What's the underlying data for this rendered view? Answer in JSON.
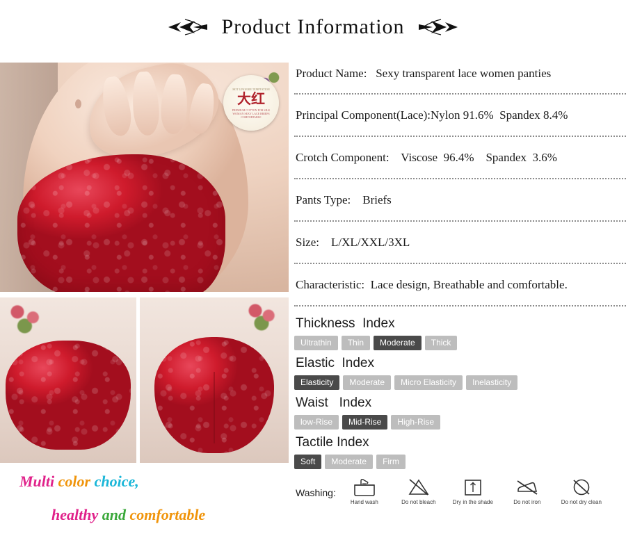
{
  "header": {
    "title": "Product  Information",
    "left_ornament_icon": "ornament-arrow-left-icon",
    "right_ornament_icon": "ornament-arrow-right-icon"
  },
  "gallery": {
    "main_photo_alt": "red lace panties front view on model",
    "bottom_left_photo_alt": "red lace panties front flat lay",
    "bottom_right_photo_alt": "red lace panties back flat lay",
    "stamp": {
      "top_text": "HOT LINGERIE TEMPTATION",
      "chinese": "大红",
      "bottom_text": "PREMIUM COTTON\nFOR SILK WOMAN\nSEXY LACE BRIEFS\nCOMFORTABLE"
    }
  },
  "slogan": {
    "line1": [
      {
        "text": "Multi ",
        "color": "#e0218a"
      },
      {
        "text": "color ",
        "color": "#f0940a"
      },
      {
        "text": "choice,",
        "color": "#19b6d8"
      }
    ],
    "line2": [
      {
        "text": "healthy ",
        "color": "#e0218a"
      },
      {
        "text": "and ",
        "color": "#3aa83a"
      },
      {
        "text": "comfortable",
        "color": "#f0940a"
      }
    ]
  },
  "specs": [
    {
      "label": "Product Name:",
      "value": "Sexy transparent lace women panties"
    },
    {
      "label": "Principal Component(Lace):",
      "value": "Nylon 91.6%  Spandex 8.4%"
    },
    {
      "label": "Crotch Component:",
      "value": "Viscose  96.4%    Spandex  3.6%"
    },
    {
      "label": "Pants Type:",
      "value": "Briefs"
    },
    {
      "label": "Size:",
      "value": "L/XL/XXL/3XL"
    },
    {
      "label": "Characteristic:",
      "value": "Lace design, Breathable and comfortable."
    }
  ],
  "spec_lines": [
    "Product Name:   Sexy transparent lace women panties",
    "Principal Component(Lace):Nylon 91.6%  Spandex 8.4%",
    "Crotch Component:    Viscose  96.4%    Spandex  3.6%",
    "Pants Type:    Briefs",
    "Size:    L/XL/XXL/3XL",
    "Characteristic:  Lace design, Breathable and comfortable."
  ],
  "indexes": [
    {
      "title": "Thickness  Index",
      "options": [
        {
          "label": "Ultrathin",
          "selected": false
        },
        {
          "label": "Thin",
          "selected": false
        },
        {
          "label": "Moderate",
          "selected": true
        },
        {
          "label": "Thick",
          "selected": false
        }
      ]
    },
    {
      "title": "Elastic  Index",
      "options": [
        {
          "label": "Elasticity",
          "selected": true
        },
        {
          "label": "Moderate",
          "selected": false
        },
        {
          "label": "Micro Elasticity",
          "selected": false
        },
        {
          "label": "Inelasticity",
          "selected": false
        }
      ]
    },
    {
      "title": "Waist   Index",
      "options": [
        {
          "label": "low-Rise",
          "selected": false
        },
        {
          "label": "Mid-Rise",
          "selected": true
        },
        {
          "label": "High-Rise",
          "selected": false
        }
      ]
    },
    {
      "title": "Tactile Index",
      "options": [
        {
          "label": "Soft",
          "selected": true
        },
        {
          "label": "Moderate",
          "selected": false
        },
        {
          "label": "Firm",
          "selected": false
        }
      ]
    }
  ],
  "washing": {
    "label": "Washing:",
    "icons": [
      {
        "icon": "hand-wash-icon",
        "caption": "Hand wash"
      },
      {
        "icon": "do-not-bleach-icon",
        "caption": "Do not bleach"
      },
      {
        "icon": "dry-in-shade-icon",
        "caption": "Dry in the shade"
      },
      {
        "icon": "do-not-iron-icon",
        "caption": "Do not iron"
      },
      {
        "icon": "do-not-dry-clean-icon",
        "caption": "Do not dry clean"
      }
    ]
  },
  "colors": {
    "chip_inactive": "#bdbdbd",
    "chip_active": "#4a4a4a",
    "product_red": "#cf1b2c",
    "divider": "#8c8c8c"
  }
}
